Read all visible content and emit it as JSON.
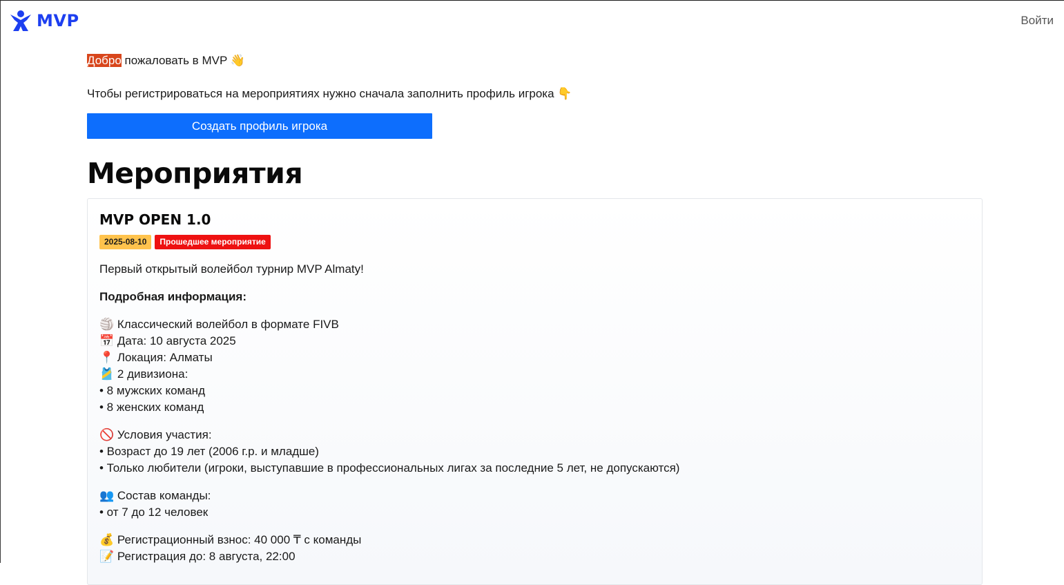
{
  "header": {
    "logo_text": "MVP",
    "login_label": "Войти"
  },
  "welcome": {
    "highlight": "Добро",
    "rest": " пожаловать в MVP 👋"
  },
  "hint_text": "Чтобы регистрироваться на мероприятиях нужно сначала заполнить профиль игрока 👇",
  "create_profile_label": "Создать профиль игрока",
  "page_title": "Мероприятия",
  "colors": {
    "brand": "#1d3ff0",
    "primary_button": "#0d6efd",
    "badge_date": "#ffc34d",
    "badge_past": "#ee1111",
    "highlight": "#d8461c"
  },
  "event": {
    "title": "MVP OPEN 1.0",
    "date_badge": "2025-08-10",
    "status_badge": "Прошедшее мероприятие",
    "short_desc": "Первый открытый волейбол турнир MVP Almaty!",
    "details_heading": "Подробная информация:",
    "format_lines": [
      "🏐 Классический волейбол в формате FIVB",
      "📅 Дата: 10 августа 2025",
      "📍 Локация: Алматы",
      "🎽 2 дивизиона:",
      "• 8 мужских команд",
      "• 8 женских команд"
    ],
    "conditions_lines": [
      "🚫 Условия участия:",
      "• Возраст до 19 лет (2006 г.р. и младше)",
      "• Только любители (игроки, выступавшие в профессиональных лигах за последние 5 лет, не допускаются)"
    ],
    "team_lines": [
      "👥 Состав команды:",
      "• от 7 до 12 человек"
    ],
    "fee_lines": [
      "💰 Регистрационный взнос: 40 000 ₸ с команды",
      "📝 Регистрация до: 8 августа, 22:00"
    ]
  }
}
